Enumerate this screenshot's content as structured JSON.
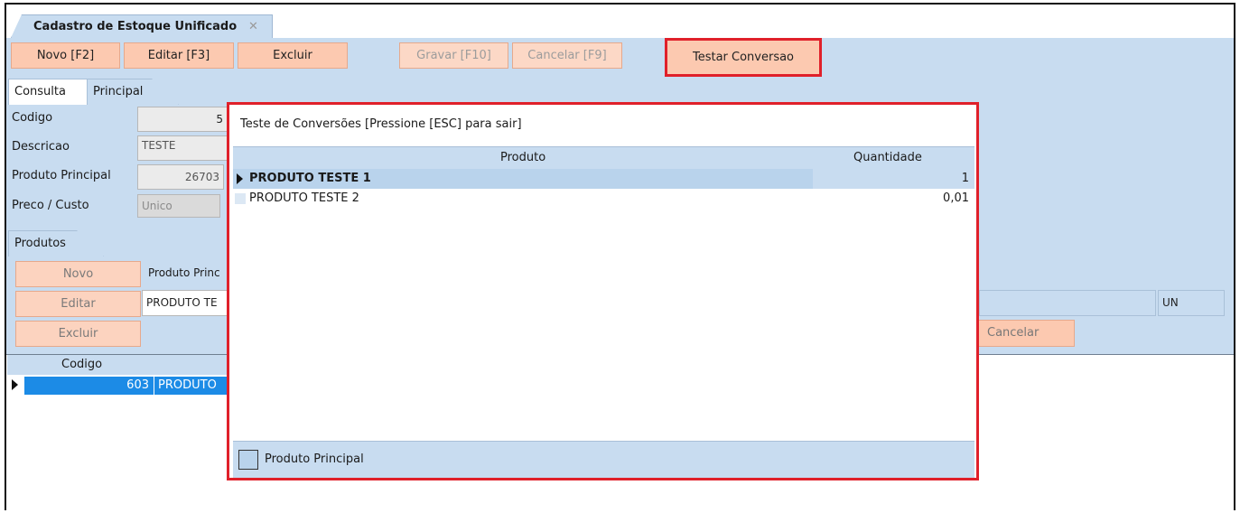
{
  "document_tab": {
    "title": "Cadastro de Estoque Unificado",
    "close": "✕"
  },
  "toolbar": {
    "novo": "Novo [F2]",
    "editar": "Editar [F3]",
    "excluir": "Excluir",
    "gravar": "Gravar [F10]",
    "cancelar": "Cancelar [F9]",
    "testar": "Testar Conversao"
  },
  "tabs": {
    "consulta": "Consulta",
    "principal": "Principal"
  },
  "form": {
    "codigo_label": "Codigo",
    "codigo_value": "5",
    "descricao_label": "Descricao",
    "descricao_value": "TESTE",
    "produto_principal_label": "Produto Principal",
    "produto_principal_value": "26703",
    "preco_custo_label": "Preco / Custo",
    "preco_custo_value": "Unico"
  },
  "produtos_section": {
    "tab": "Produtos",
    "novo": "Novo",
    "editar": "Editar",
    "excluir": "Excluir",
    "produto_princ_label": "Produto Princ",
    "produto_value": "PRODUTO TE",
    "unit": "UN",
    "cancelar": "Cancelar"
  },
  "bottom_grid": {
    "header_codigo": "Codigo",
    "row_codigo": "603",
    "row_produto": "PRODUTO T"
  },
  "modal": {
    "title": "Teste de Conversões [Pressione [ESC] para sair]",
    "col_produto": "Produto",
    "col_quantidade": "Quantidade",
    "rows": [
      {
        "produto": "PRODUTO TESTE 1",
        "quantidade": "1"
      },
      {
        "produto": "PRODUTO TESTE 2",
        "quantidade": "0,01"
      }
    ],
    "legend": "Produto Principal"
  },
  "colors": {
    "panel": "#c8dcf0",
    "button": "#fcc9b0",
    "highlight": "#e0202a",
    "selected_row": "#1c8be6"
  }
}
